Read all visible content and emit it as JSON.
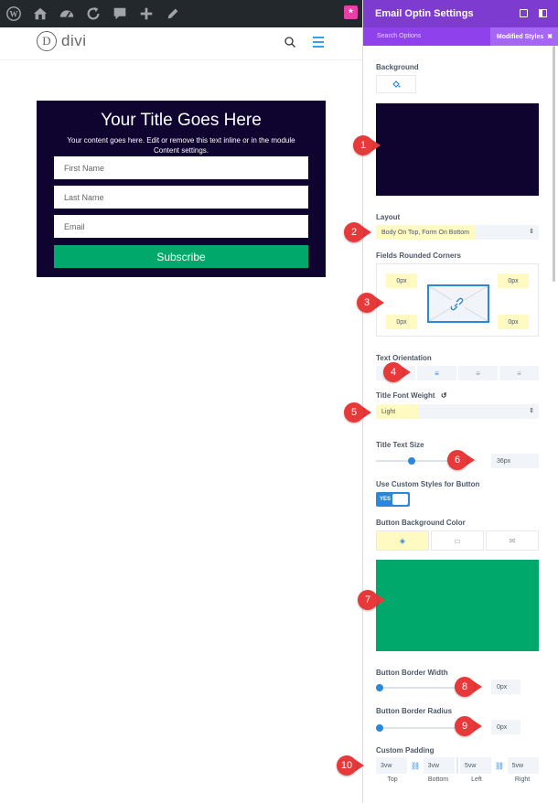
{
  "admin_bar": {
    "icons": [
      "wordpress-icon",
      "home-network-icon",
      "dashboard-icon",
      "refresh-icon",
      "comment-icon",
      "plus-icon",
      "pencil-icon"
    ],
    "divi_badge": "*"
  },
  "site": {
    "logo_letter": "D",
    "logo_text": "divi"
  },
  "optin": {
    "title": "Your Title Goes Here",
    "description": "Your content goes here. Edit or remove this text inline or in the module Content settings.",
    "fields": [
      "First Name",
      "Last Name",
      "Email"
    ],
    "button": "Subscribe",
    "bg_color": "#0f0330",
    "button_color": "#00a96b"
  },
  "panel": {
    "title": "Email Optin Settings",
    "search_options": "Search Options",
    "modified_styles": "Modified Styles",
    "modified_close": "✖",
    "background_label": "Background",
    "background_color": "#0f0330",
    "layout_label": "Layout",
    "layout_value": "Body On Top, Form On Bottom",
    "corners_label": "Fields Rounded Corners",
    "corners": [
      "0px",
      "0px",
      "0px",
      "0px"
    ],
    "orientation_label": "Text Orientation",
    "font_weight_label": "Title Font Weight",
    "font_weight_value": "Light",
    "text_size_label": "Title Text Size",
    "text_size_value": "36px",
    "text_size_slider": 0.35,
    "custom_styles_label": "Use Custom Styles for Button",
    "toggle_label": "YES",
    "button_bg_label": "Button Background Color",
    "button_bg_color": "#00a96b",
    "border_width_label": "Button Border Width",
    "border_width_value": "0px",
    "border_radius_label": "Button Border Radius",
    "border_radius_value": "0px",
    "padding_label": "Custom Padding",
    "padding_values": [
      "3vw",
      "3vw",
      "5vw",
      "5vw"
    ],
    "padding_sides": [
      "Top",
      "Bottom",
      "Left",
      "Right"
    ]
  },
  "callouts": [
    "1",
    "2",
    "3",
    "4",
    "5",
    "6",
    "7",
    "8",
    "9",
    "10"
  ]
}
